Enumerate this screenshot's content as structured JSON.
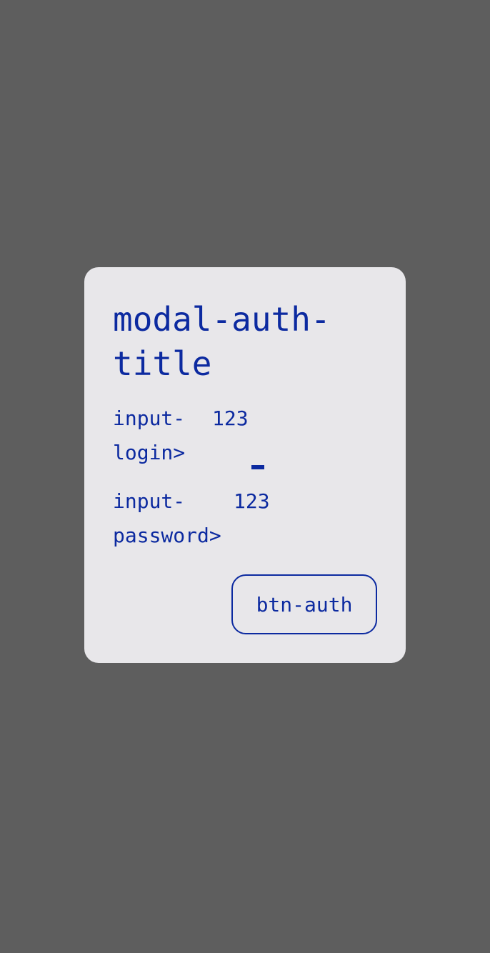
{
  "colors": {
    "backdrop": "#5e5e5e",
    "modal_background": "#e8e7ea",
    "accent": "#0c2aa0"
  },
  "modal": {
    "title": "modal-auth-title",
    "login": {
      "label": "input-login>",
      "value": "123"
    },
    "password": {
      "label": "input-password>",
      "value": "123"
    },
    "button_label": "btn-auth"
  }
}
